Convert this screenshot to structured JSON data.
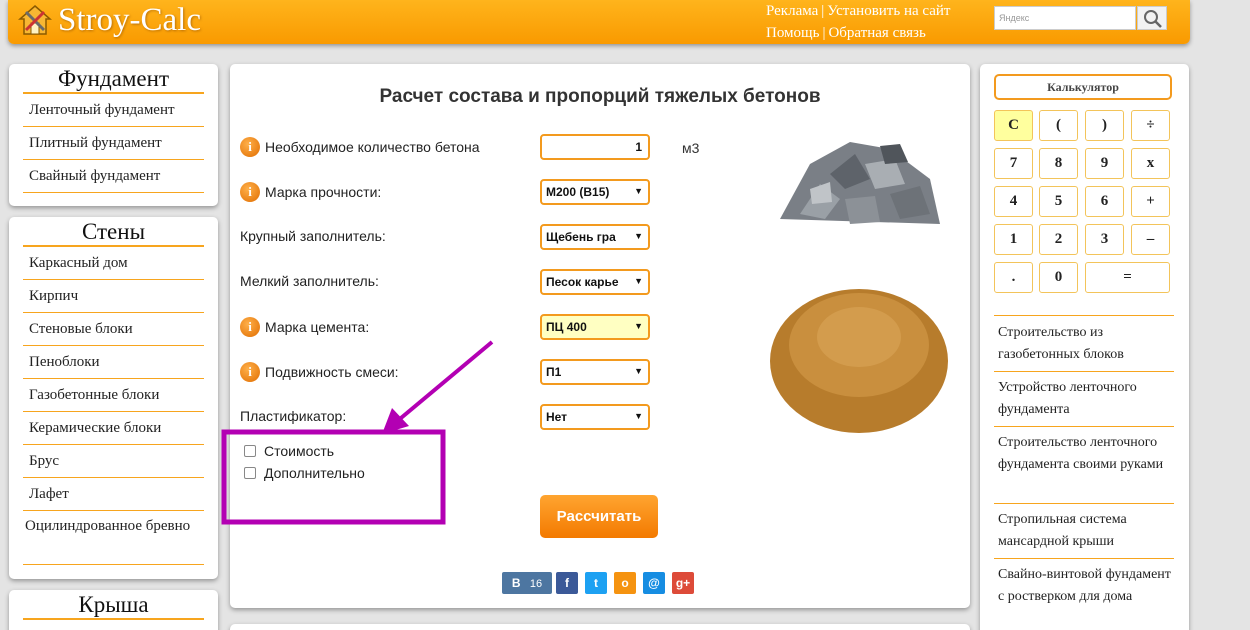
{
  "header": {
    "logo": "Stroy-Calc",
    "links": [
      "Реклама",
      "Установить на сайт",
      "Помощь",
      "Обратная связь"
    ],
    "search_placeholder": "Яндекс"
  },
  "left": {
    "sections": [
      {
        "title": "Фундамент",
        "items": [
          "Ленточный фундамент",
          "Плитный фундамент",
          "Свайный фундамент"
        ]
      },
      {
        "title": "Стены",
        "items": [
          "Каркасный дом",
          "Кирпич",
          "Стеновые блоки",
          "Пеноблоки",
          "Газобетонные блоки",
          "Керамические блоки",
          "Брус",
          "Лафет",
          "Оцилиндрованное бревно"
        ]
      },
      {
        "title": "Крыша",
        "items": []
      }
    ]
  },
  "main": {
    "title": "Расчет состава и пропорций тяжелых бетонов",
    "rows": [
      {
        "label": "Необходимое количество бетона",
        "value": "1",
        "unit": "м3"
      },
      {
        "label": "Марка прочности:",
        "value": "М200 (В15)"
      },
      {
        "label": "Крупный заполнитель:",
        "value": "Щебень гра"
      },
      {
        "label": "Мелкий заполнитель:",
        "value": "Песок карье"
      },
      {
        "label": "Марка цемента:",
        "value": "ПЦ 400"
      },
      {
        "label": "Подвижность смеси:",
        "value": "П1"
      },
      {
        "label": "Пластификатор:",
        "value": "Нет"
      }
    ],
    "checkboxes": [
      "Стоимость",
      "Дополнительно"
    ],
    "calc_button": "Рассчитать",
    "social": {
      "vk_count": "16"
    }
  },
  "right": {
    "calc_title": "Калькулятор",
    "keys": [
      "C",
      "(",
      ")",
      "÷",
      "7",
      "8",
      "9",
      "x",
      "4",
      "5",
      "6",
      "+",
      "1",
      "2",
      "3",
      "–",
      ".",
      "0",
      "="
    ],
    "links": [
      "Строительство из газобетонных блоков",
      "Устройство ленточного фундамента",
      "Строительство ленточного фундамента своими руками",
      "Стропильная система мансардной крыши",
      "Свайно-винтовой фундамент с ростверком для дома"
    ]
  },
  "colors": {
    "accent": "#f7a51e",
    "annotation": "#b300b3"
  }
}
